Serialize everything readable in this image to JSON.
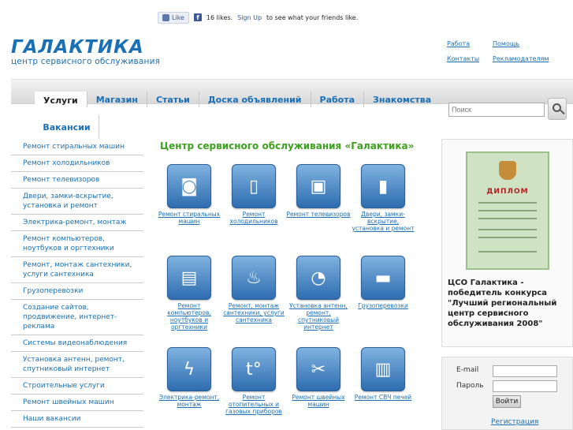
{
  "facebook": {
    "like_label": "Like",
    "likes_text": "16 likes.",
    "signup_link": "Sign Up",
    "signup_suffix": "to see what your friends like."
  },
  "logo": {
    "title": "ГАЛАКТИКА",
    "subtitle": "центр сервисного обслуживания"
  },
  "top_links": [
    "Работа",
    "Помощь",
    "Контакты",
    "Рекламодателям"
  ],
  "nav": {
    "tabs": [
      "Услуги",
      "Магазин",
      "Статьи",
      "Доска объявлений",
      "Работа",
      "Знакомства"
    ],
    "second_row": "Вакансии",
    "search_placeholder": "Поиск"
  },
  "sidebar": [
    "Ремонт стиральных машин",
    "Ремонт холодильников",
    "Ремонт телевизоров",
    "Двери, замки-вскрытие, установка и ремонт",
    "Электрика-ремонт, монтаж",
    "Ремонт компьютеров, ноутбуков и оргтехники",
    "Ремонт, монтаж сантехники, услуги сантехника",
    "Грузоперевозки",
    "Создание сайтов, продвижение, интернет-реклама",
    "Системы видеонаблюдения",
    "Установка антенн, ремонт, спутниковый интернет",
    "Строительные услуги",
    "Ремонт швейных машин",
    "Наши вакансии"
  ],
  "main": {
    "title": "Центр сервисного обслуживания «Галактика»",
    "services": [
      {
        "caption": "Ремонт стиральных машин",
        "icon": "washer-icon"
      },
      {
        "caption": "Ремонт холодильников",
        "icon": "fridge-icon"
      },
      {
        "caption": "Ремонт телевизоров",
        "icon": "tv-icon"
      },
      {
        "caption": "Двери, замки-вскрытие, установка и ремонт",
        "icon": "door-icon"
      },
      {
        "caption": "Ремонт компьютеров, ноутбуков и оргтехники",
        "icon": "computer-icon"
      },
      {
        "caption": "Ремонт, монтаж сантехники, услуги сантехника",
        "icon": "faucet-icon"
      },
      {
        "caption": "Установка антенн, ремонт, спутниковый интернет",
        "icon": "satellite-icon"
      },
      {
        "caption": "Грузоперевозки",
        "icon": "truck-icon"
      },
      {
        "caption": "Электрика-ремонт, монтаж",
        "icon": "electric-icon"
      },
      {
        "caption": "Ремонт отопительных и газовых приборов",
        "icon": "boiler-icon"
      },
      {
        "caption": "Ремонт швейных машин",
        "icon": "sewing-icon"
      },
      {
        "caption": "Ремонт СВЧ печей",
        "icon": "microwave-icon"
      }
    ]
  },
  "award": {
    "diploma_title": "ДИПЛОМ",
    "text": "ЦСО Галактика - победитель конкурса \"Лучший региональный центр сервисного обслуживания 2008\""
  },
  "login": {
    "email_label": "E-mail",
    "password_label": "Пароль",
    "submit": "Войти",
    "register": "Регистрация"
  }
}
